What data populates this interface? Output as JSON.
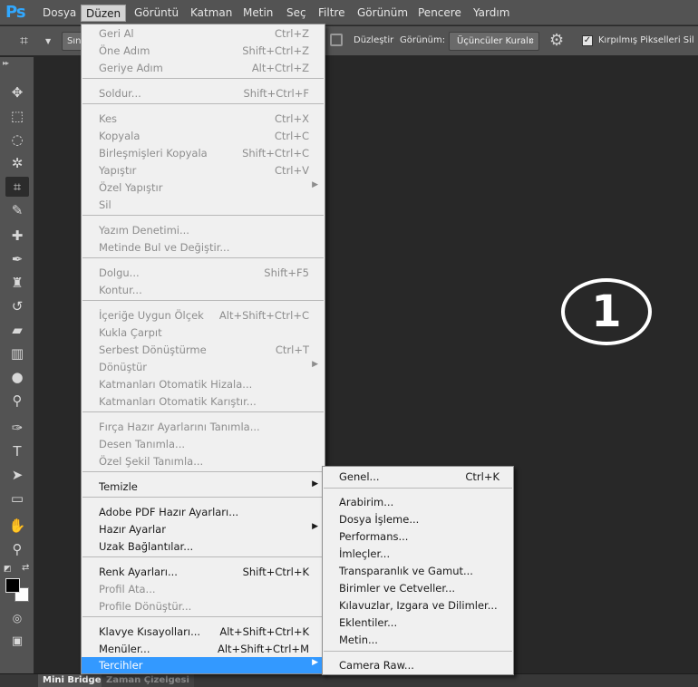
{
  "app": {
    "logo": "Ps"
  },
  "menubar": {
    "items": [
      "Dosya",
      "Düzen",
      "Görüntü",
      "Katman",
      "Metin",
      "Seç",
      "Filtre",
      "Görünüm",
      "Pencere",
      "Yardım"
    ],
    "active": "Düzen"
  },
  "options": {
    "preset_button": "Sın",
    "straighten_label": "Düzleştir",
    "view_label": "Görünüm:",
    "view_value": "Üçüncüler Kuralı",
    "delete_cropped_label": "Kırpılmış Pikselleri Sil",
    "delete_cropped_checked": true
  },
  "edit_menu": {
    "undo": "Geri Al",
    "undo_sc": "Ctrl+Z",
    "step_forward": "Öne Adım",
    "step_forward_sc": "Shift+Ctrl+Z",
    "step_backward": "Geriye Adım",
    "step_backward_sc": "Alt+Ctrl+Z",
    "fade": "Soldur...",
    "fade_sc": "Shift+Ctrl+F",
    "cut": "Kes",
    "cut_sc": "Ctrl+X",
    "copy": "Kopyala",
    "copy_sc": "Ctrl+C",
    "copy_merged": "Birleşmişleri Kopyala",
    "copy_merged_sc": "Shift+Ctrl+C",
    "paste": "Yapıştır",
    "paste_sc": "Ctrl+V",
    "paste_special": "Özel Yapıştır",
    "clear": "Sil",
    "check_spelling": "Yazım Denetimi...",
    "find_replace": "Metinde Bul ve Değiştir...",
    "fill": "Dolgu...",
    "fill_sc": "Shift+F5",
    "stroke": "Kontur...",
    "content_aware_scale": "İçeriğe Uygun Ölçek",
    "content_aware_scale_sc": "Alt+Shift+Ctrl+C",
    "puppet_warp": "Kukla Çarpıt",
    "free_transform": "Serbest Dönüştürme",
    "free_transform_sc": "Ctrl+T",
    "transform": "Dönüştür",
    "auto_align": "Katmanları Otomatik Hizala...",
    "auto_blend": "Katmanları Otomatik Karıştır...",
    "define_brush": "Fırça Hazır Ayarlarını Tanımla...",
    "define_pattern": "Desen Tanımla...",
    "define_shape": "Özel Şekil Tanımla...",
    "purge": "Temizle",
    "pdf_presets": "Adobe PDF Hazır Ayarları...",
    "presets": "Hazır Ayarlar",
    "remote_connections": "Uzak Bağlantılar...",
    "color_settings": "Renk Ayarları...",
    "color_settings_sc": "Shift+Ctrl+K",
    "assign_profile": "Profil Ata...",
    "convert_profile": "Profile Dönüştür...",
    "keyboard_shortcuts": "Klavye Kısayolları...",
    "keyboard_shortcuts_sc": "Alt+Shift+Ctrl+K",
    "menus": "Menüler...",
    "menus_sc": "Alt+Shift+Ctrl+M",
    "preferences": "Tercihler"
  },
  "preferences_submenu": {
    "general": "Genel...",
    "general_sc": "Ctrl+K",
    "interface": "Arabirim...",
    "file_handling": "Dosya İşleme...",
    "performance": "Performans...",
    "cursors": "İmleçler...",
    "transparency": "Transparanlık ve Gamut...",
    "units": "Birimler ve Cetveller...",
    "guides": "Kılavuzlar, Izgara ve Dilimler...",
    "plugins": "Eklentiler...",
    "type": "Metin...",
    "camera_raw": "Camera Raw..."
  },
  "canvas": {
    "step_number": "1"
  },
  "bottom_tabs": {
    "active": "Mini Bridge",
    "inactive": "Zaman Çizelgesi"
  },
  "colors": {
    "highlight": "#3399ff",
    "foreground": "#000000",
    "background": "#ffffff"
  }
}
